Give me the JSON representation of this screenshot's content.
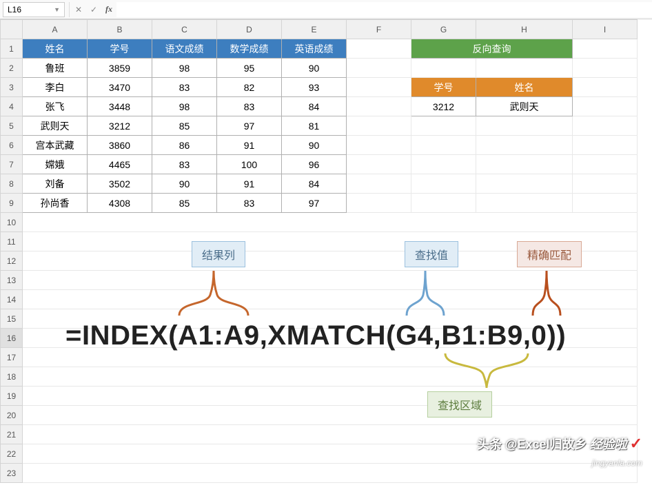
{
  "namebox": "L16",
  "formula_input": "",
  "columns": [
    "A",
    "B",
    "C",
    "D",
    "E",
    "F",
    "G",
    "H",
    "I"
  ],
  "row_count": 23,
  "main_headers": [
    "姓名",
    "学号",
    "语文成绩",
    "数学成绩",
    "英语成绩"
  ],
  "main_rows": [
    [
      "鲁班",
      "3859",
      "98",
      "95",
      "90"
    ],
    [
      "李白",
      "3470",
      "83",
      "82",
      "93"
    ],
    [
      "张飞",
      "3448",
      "98",
      "83",
      "84"
    ],
    [
      "武则天",
      "3212",
      "85",
      "97",
      "81"
    ],
    [
      "宫本武藏",
      "3860",
      "86",
      "91",
      "90"
    ],
    [
      "嫦娥",
      "4465",
      "83",
      "100",
      "96"
    ],
    [
      "刘备",
      "3502",
      "90",
      "91",
      "84"
    ],
    [
      "孙尚香",
      "4308",
      "85",
      "83",
      "97"
    ]
  ],
  "lookup": {
    "title": "反向查询",
    "headers": [
      "学号",
      "姓名"
    ],
    "row": [
      "3212",
      "武则天"
    ]
  },
  "labels": {
    "result_col": "结果列",
    "lookup_val": "查找值",
    "exact_match": "精确匹配",
    "lookup_range": "查找区域"
  },
  "formula_text": "=INDEX(A1:A9,XMATCH(G4,B1:B9,0))",
  "watermark1": "头条 @Excel归故乡",
  "watermark2": "经验啦",
  "watermark3": "jingyanla.com",
  "colors": {
    "blue_hdr": "#3d7ebf",
    "green_hdr": "#5da24a",
    "orange_hdr": "#e08a2b"
  },
  "chart_data": {
    "type": "table",
    "title": "学生成绩与反向查询示例",
    "main_table": {
      "columns": [
        "姓名",
        "学号",
        "语文成绩",
        "数学成绩",
        "英语成绩"
      ],
      "rows": [
        [
          "鲁班",
          3859,
          98,
          95,
          90
        ],
        [
          "李白",
          3470,
          83,
          82,
          93
        ],
        [
          "张飞",
          3448,
          98,
          83,
          84
        ],
        [
          "武则天",
          3212,
          85,
          97,
          81
        ],
        [
          "宫本武藏",
          3860,
          86,
          91,
          90
        ],
        [
          "嫦娥",
          4465,
          83,
          100,
          96
        ],
        [
          "刘备",
          3502,
          90,
          91,
          84
        ],
        [
          "孙尚香",
          4308,
          85,
          83,
          97
        ]
      ]
    },
    "lookup_table": {
      "title": "反向查询",
      "columns": [
        "学号",
        "姓名"
      ],
      "rows": [
        [
          3212,
          "武则天"
        ]
      ]
    },
    "formula": "=INDEX(A1:A9,XMATCH(G4,B1:B9,0))",
    "formula_parts": {
      "result_column": "A1:A9",
      "lookup_value": "G4",
      "lookup_array": "B1:B9",
      "match_mode": 0
    }
  }
}
